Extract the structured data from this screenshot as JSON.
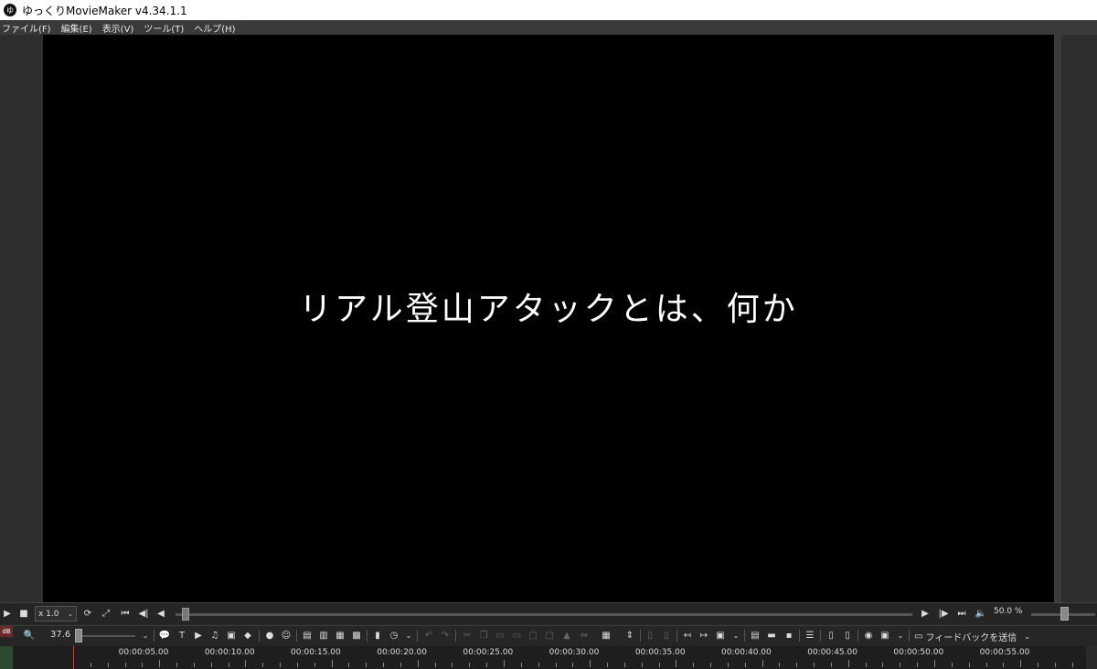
{
  "window": {
    "title": "ゆっくりMovieMaker v4.34.1.1",
    "icon": "ゆ"
  },
  "menu": {
    "items": [
      "ファイル(F)",
      "編集(E)",
      "表示(V)",
      "ツール(T)",
      "ヘルプ(H)"
    ]
  },
  "preview": {
    "subtitle": "リアル登山アタックとは、何か"
  },
  "playback": {
    "speed": "x 1.0",
    "volume": "50.0 %",
    "seek_position_fraction": 0.01,
    "volume_level_fraction": 0.5
  },
  "toolbar": {
    "db_label": "dB",
    "zoom_value": "37.6",
    "feedback_label": "フィードバックを送信"
  },
  "timeline": {
    "ticks": [
      "00:00:05.00",
      "00:00:10.00",
      "00:00:15.00",
      "00:00:20.00",
      "00:00:25.00",
      "00:00:30.00",
      "00:00:35.00",
      "00:00:40.00",
      "00:00:45.00",
      "00:00:50.00",
      "00:00:55.00"
    ]
  },
  "colors": {
    "canvas": "#000000",
    "playhead": "#ee3333",
    "app_bg": "#2b2b2b"
  }
}
